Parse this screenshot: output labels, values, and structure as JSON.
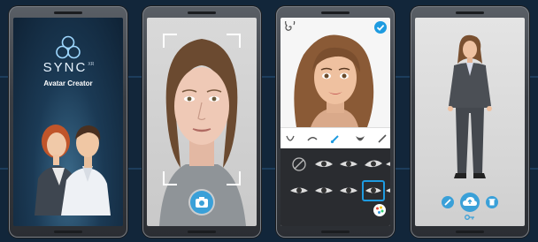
{
  "screens": [
    {
      "id": "splash",
      "brand_text": "SYNC",
      "brand_suffix": "XR",
      "subtitle": "Avatar Creator"
    },
    {
      "id": "photo-capture",
      "capture_icon": "camera-icon"
    },
    {
      "id": "face-editor",
      "confirm_icon": "check-icon",
      "tools": [
        "face-shape-icon",
        "eyebrow-icon",
        "brush-icon",
        "beard-icon",
        "pencil-icon"
      ],
      "eye_options_count": 11,
      "selected_option_index": 9
    },
    {
      "id": "avatar-preview",
      "actions": [
        "edit-icon",
        "cloud-upload-icon",
        "delete-icon"
      ],
      "key_icon": "key-icon"
    }
  ],
  "colors": {
    "accent": "#3aa0d8",
    "background": "#12263a"
  }
}
